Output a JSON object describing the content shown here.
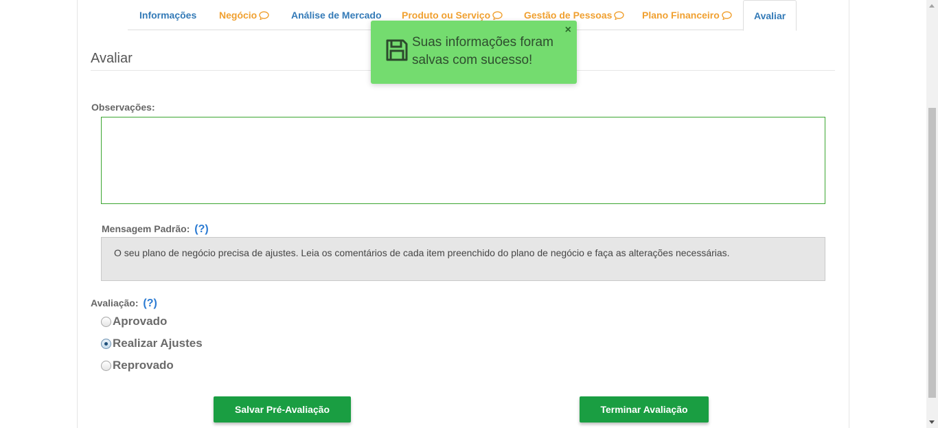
{
  "tabs": [
    {
      "label": "Informações",
      "comment_icon": false,
      "color": "#337ab7"
    },
    {
      "label": "Negócio",
      "comment_icon": true,
      "color": "#f0a030"
    },
    {
      "label": "Análise de Mercado",
      "comment_icon": false,
      "color": "#337ab7"
    },
    {
      "label": "Produto ou Serviço",
      "comment_icon": true,
      "color": "#f0a030"
    },
    {
      "label": "Gestão de Pessoas",
      "comment_icon": true,
      "color": "#f0a030"
    },
    {
      "label": "Plano Financeiro",
      "comment_icon": true,
      "color": "#f0a030"
    },
    {
      "label": "Avaliar",
      "comment_icon": false,
      "active": true,
      "color": "#337ab7"
    }
  ],
  "section": {
    "title": "Avaliar"
  },
  "observacoes": {
    "label": "Observações:",
    "value": ""
  },
  "mensagem_padrao": {
    "label": "Mensagem Padrão:",
    "help": "(?)",
    "text": "O seu plano de negócio precisa de ajustes. Leia os comentários de cada item preenchido do plano de negócio e faça as alterações necessárias."
  },
  "avaliacao": {
    "label": "Avaliação:",
    "help": "(?)",
    "options": [
      {
        "label": "Aprovado",
        "checked": false
      },
      {
        "label": "Realizar Ajustes",
        "checked": true
      },
      {
        "label": "Reprovado",
        "checked": false
      }
    ]
  },
  "buttons": {
    "save_pre": "Salvar Pré-Avaliação",
    "finish": "Terminar Avaliação",
    "color": "#1a9e42"
  },
  "toast": {
    "message": "Suas informações foram salvas com sucesso!",
    "close": "×",
    "icon": "floppy-disk-icon",
    "color": "#74dc6f"
  }
}
